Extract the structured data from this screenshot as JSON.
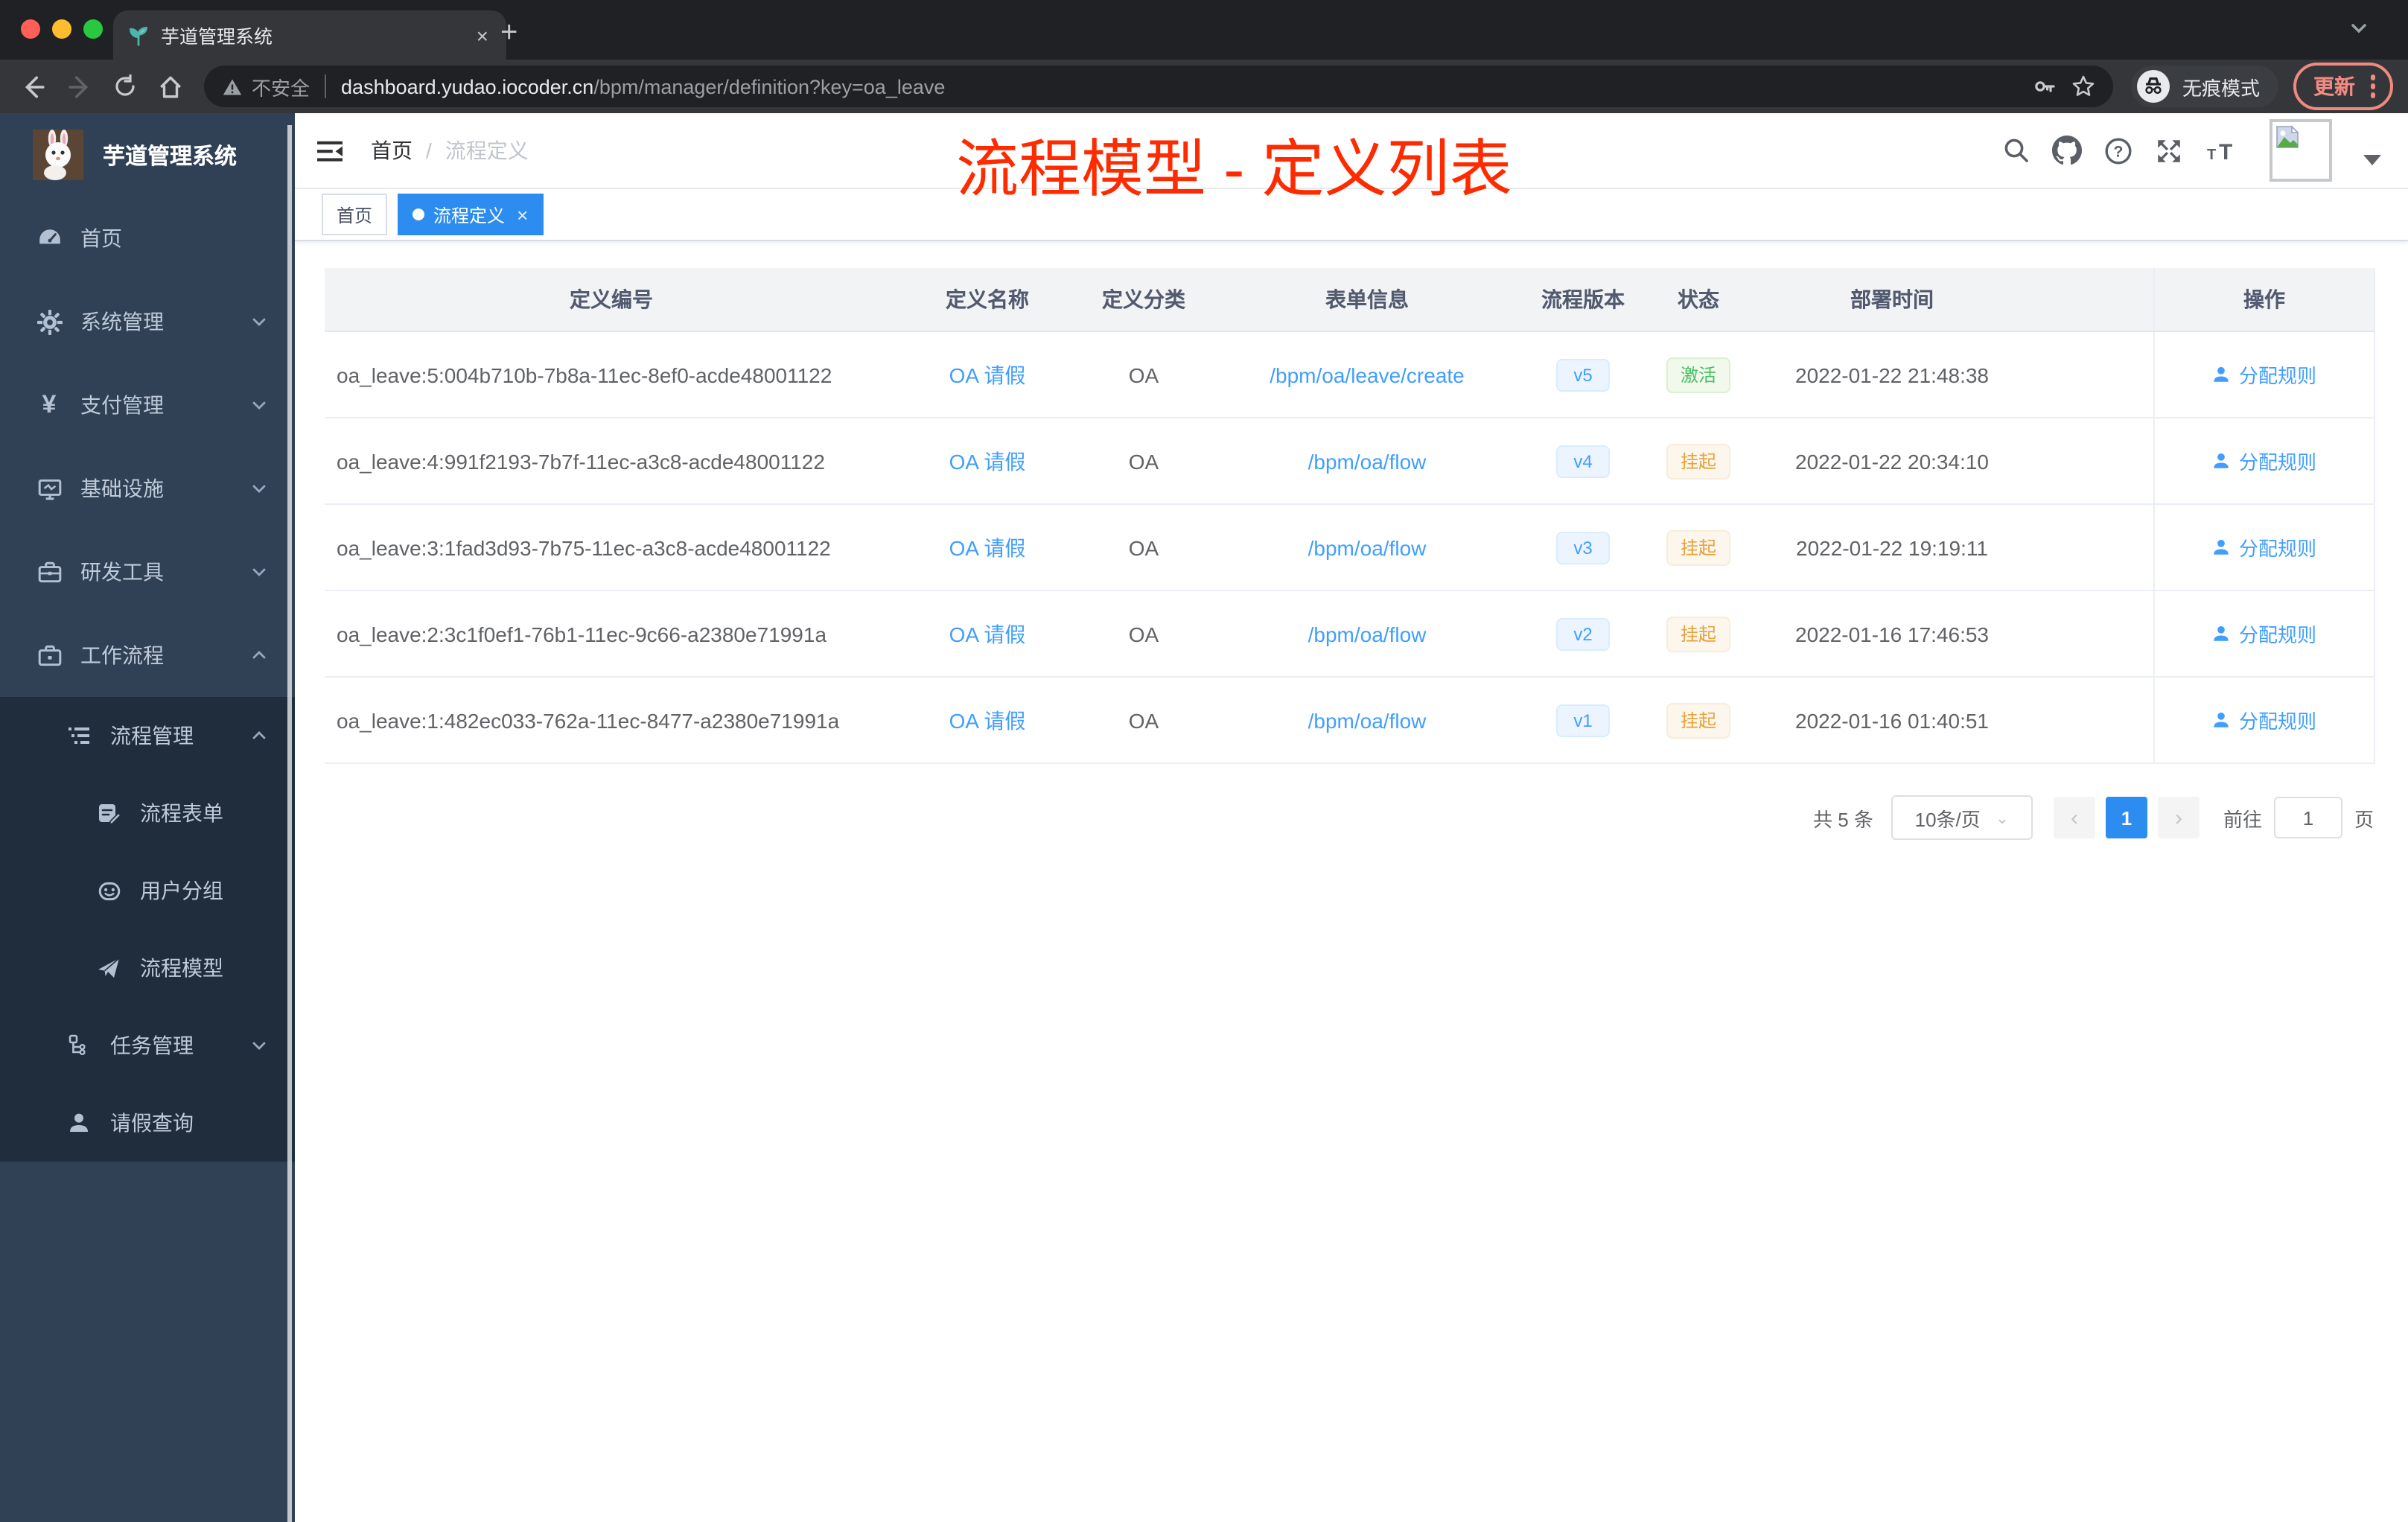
{
  "browser": {
    "tab_title": "芋道管理系统",
    "tab_close": "×",
    "new_tab": "+",
    "security_label": "不安全",
    "url_host": "dashboard.yudao.iocoder.cn",
    "url_path": "/bpm/manager/definition?key=oa_leave",
    "incognito_label": "无痕模式",
    "update_label": "更新"
  },
  "sidebar": {
    "logo_title": "芋道管理系统",
    "menu": [
      {
        "label": "首页"
      },
      {
        "label": "系统管理"
      },
      {
        "label": "支付管理"
      },
      {
        "label": "基础设施"
      },
      {
        "label": "研发工具"
      },
      {
        "label": "工作流程"
      }
    ],
    "submenu": [
      {
        "label": "流程管理"
      },
      {
        "label": "流程表单"
      },
      {
        "label": "用户分组"
      },
      {
        "label": "流程模型"
      },
      {
        "label": "任务管理"
      },
      {
        "label": "请假查询"
      }
    ]
  },
  "header": {
    "breadcrumb_home": "首页",
    "breadcrumb_sep": "/",
    "breadcrumb_current": "流程定义",
    "annotation": "流程模型 - 定义列表"
  },
  "tags": {
    "home": "首页",
    "active": "流程定义",
    "close": "×"
  },
  "table": {
    "columns": {
      "id": "定义编号",
      "name": "定义名称",
      "category": "定义分类",
      "form": "表单信息",
      "version": "流程版本",
      "status": "状态",
      "deploy_time": "部署时间",
      "actions": "操作"
    },
    "action_label": "分配规则",
    "rows": [
      {
        "id": "oa_leave:5:004b710b-7b8a-11ec-8ef0-acde48001122",
        "name": "OA 请假",
        "category": "OA",
        "form": "/bpm/oa/leave/create",
        "version": "v5",
        "status": "激活",
        "time": "2022-01-22 21:48:38"
      },
      {
        "id": "oa_leave:4:991f2193-7b7f-11ec-a3c8-acde48001122",
        "name": "OA 请假",
        "category": "OA",
        "form": "/bpm/oa/flow",
        "version": "v4",
        "status": "挂起",
        "time": "2022-01-22 20:34:10"
      },
      {
        "id": "oa_leave:3:1fad3d93-7b75-11ec-a3c8-acde48001122",
        "name": "OA 请假",
        "category": "OA",
        "form": "/bpm/oa/flow",
        "version": "v3",
        "status": "挂起",
        "time": "2022-01-22 19:19:11"
      },
      {
        "id": "oa_leave:2:3c1f0ef1-76b1-11ec-9c66-a2380e71991a",
        "name": "OA 请假",
        "category": "OA",
        "form": "/bpm/oa/flow",
        "version": "v2",
        "status": "挂起",
        "time": "2022-01-16 17:46:53"
      },
      {
        "id": "oa_leave:1:482ec033-762a-11ec-8477-a2380e71991a",
        "name": "OA 请假",
        "category": "OA",
        "form": "/bpm/oa/flow",
        "version": "v1",
        "status": "挂起",
        "time": "2022-01-16 01:40:51"
      }
    ]
  },
  "pagination": {
    "total": "共 5 条",
    "page_size": "10条/页",
    "prev": "‹",
    "page": "1",
    "next": "›",
    "goto": "前往",
    "goto_value": "1",
    "unit": "页"
  },
  "colors": {
    "accent": "#409EFF",
    "tag_active": "#2d8cf0",
    "success_text": "#47c162",
    "warning_text": "#e6a23c",
    "annotation_red": "#ff2b00",
    "sidebar_bg": "#304156",
    "submenu_bg": "#1f2d3d"
  }
}
